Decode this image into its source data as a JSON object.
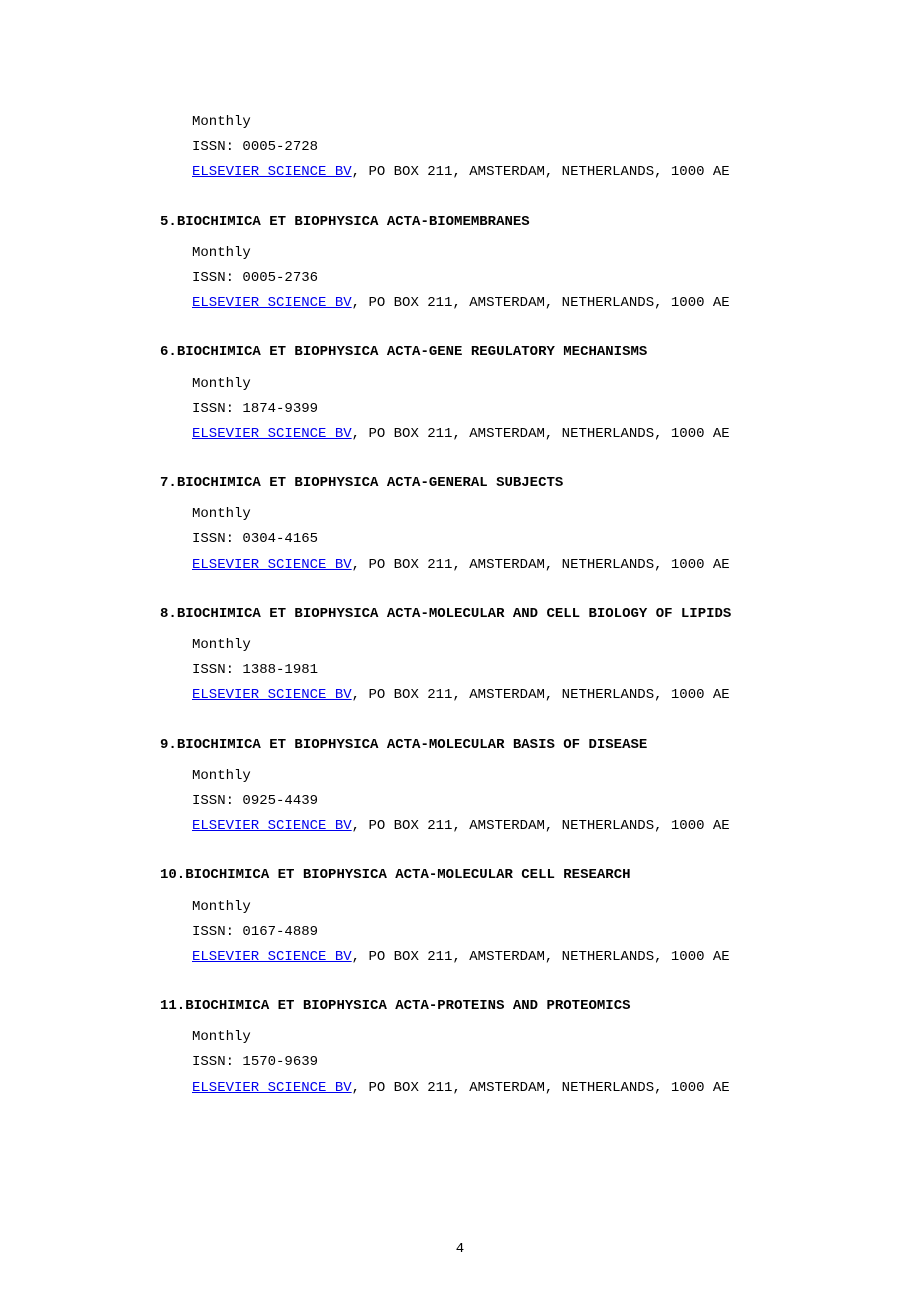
{
  "entries": [
    {
      "number": "",
      "title": "",
      "frequency": "Monthly",
      "issn_label": "ISSN:",
      "issn": "0005-2728",
      "publisher": "ELSEVIER SCIENCE BV",
      "address": ", PO BOX 211, AMSTERDAM, NETHERLANDS, 1000 AE"
    },
    {
      "number": "5.",
      "title": "BIOCHIMICA ET BIOPHYSICA ACTA-BIOMEMBRANES",
      "frequency": "Monthly",
      "issn_label": "ISSN:",
      "issn": "0005-2736",
      "publisher": "ELSEVIER SCIENCE BV",
      "address": ", PO BOX 211, AMSTERDAM, NETHERLANDS, 1000 AE"
    },
    {
      "number": "6.",
      "title": "BIOCHIMICA ET BIOPHYSICA ACTA-GENE REGULATORY MECHANISMS",
      "frequency": "Monthly",
      "issn_label": "ISSN:",
      "issn": "1874-9399",
      "publisher": "ELSEVIER SCIENCE BV",
      "address": ", PO BOX 211, AMSTERDAM, NETHERLANDS, 1000 AE"
    },
    {
      "number": "7.",
      "title": "BIOCHIMICA ET BIOPHYSICA ACTA-GENERAL SUBJECTS",
      "frequency": "Monthly",
      "issn_label": "ISSN:",
      "issn": "0304-4165",
      "publisher": "ELSEVIER SCIENCE BV",
      "address": ", PO BOX 211, AMSTERDAM, NETHERLANDS, 1000 AE"
    },
    {
      "number": "8.",
      "title": "BIOCHIMICA ET BIOPHYSICA ACTA-MOLECULAR AND CELL BIOLOGY OF LIPIDS",
      "frequency": "Monthly",
      "issn_label": "ISSN:",
      "issn": "1388-1981",
      "publisher": "ELSEVIER SCIENCE BV",
      "address": ", PO BOX 211, AMSTERDAM, NETHERLANDS, 1000 AE"
    },
    {
      "number": "9.",
      "title": "BIOCHIMICA ET BIOPHYSICA ACTA-MOLECULAR BASIS OF DISEASE",
      "frequency": "Monthly",
      "issn_label": "ISSN:",
      "issn": "0925-4439",
      "publisher": "ELSEVIER SCIENCE BV",
      "address": ", PO BOX 211, AMSTERDAM, NETHERLANDS, 1000 AE"
    },
    {
      "number": "10.",
      "title": "BIOCHIMICA ET BIOPHYSICA ACTA-MOLECULAR CELL RESEARCH",
      "frequency": "Monthly",
      "issn_label": "ISSN:",
      "issn": "0167-4889",
      "publisher": "ELSEVIER SCIENCE BV",
      "address": ", PO BOX 211, AMSTERDAM, NETHERLANDS, 1000 AE"
    },
    {
      "number": "11.",
      "title": "BIOCHIMICA ET BIOPHYSICA ACTA-PROTEINS AND PROTEOMICS",
      "frequency": "Monthly",
      "issn_label": "ISSN:",
      "issn": "1570-9639",
      "publisher": "ELSEVIER SCIENCE BV",
      "address": ", PO BOX 211, AMSTERDAM, NETHERLANDS, 1000 AE"
    }
  ],
  "pageNumber": "4"
}
